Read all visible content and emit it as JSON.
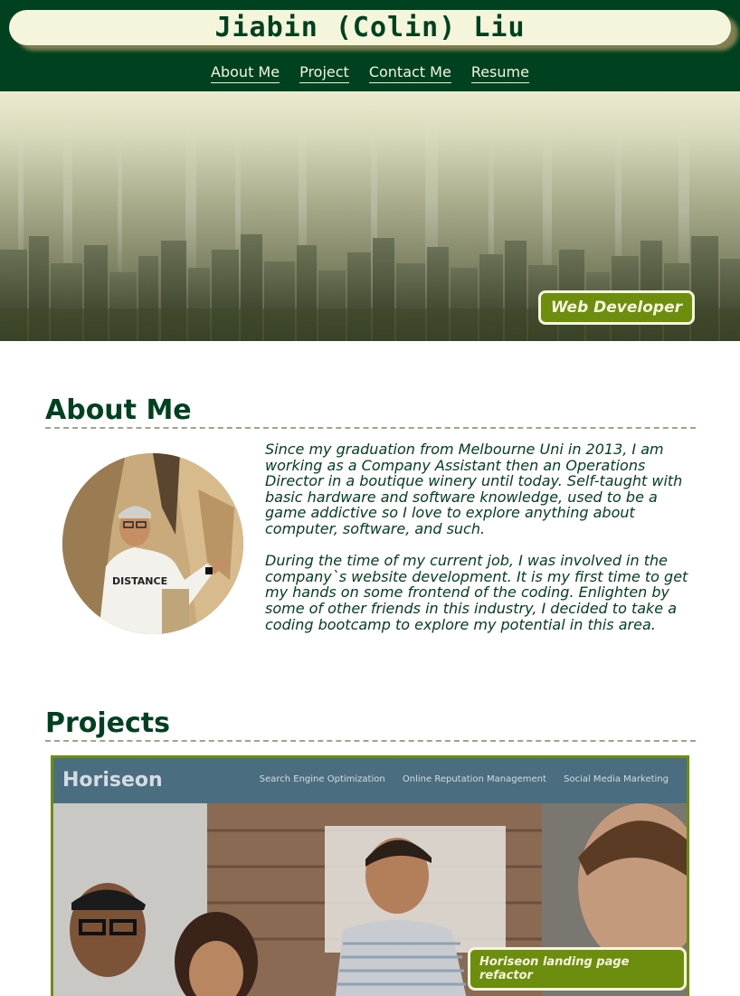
{
  "header": {
    "title": "Jiabin (Colin) Liu",
    "nav": [
      "About Me",
      "Project",
      "Contact Me",
      "Resume"
    ]
  },
  "hero": {
    "badge": "Web Developer"
  },
  "about": {
    "heading": "About Me",
    "paragraphs": [
      "Since my graduation from Melbourne Uni in 2013, I am working as a Company Assistant then an Operations Director in a boutique winery until today. Self-taught with basic hardware and software knowledge, used to be a game addictive so I love to explore anything about computer, software, and such.",
      "During the time of my current job, I was involved in the company`s website development. It is my first time to get my hands on some frontend of the coding. Enlighten by some of other friends in this industry, I decided to take a coding bootcamp to explore my potential in this area."
    ],
    "avatar_shirt_text": "DISTANCE"
  },
  "projects": {
    "heading": "Projects",
    "items": [
      {
        "logo": "Horiseon",
        "links": [
          "Search Engine Optimization",
          "Online Reputation Management",
          "Social Media Marketing"
        ],
        "label": "Horiseon landing page refactor"
      }
    ]
  },
  "colors": {
    "header_bg": "#00411f",
    "cream": "#f5f5dc",
    "accent_green": "#6c8d0e"
  }
}
